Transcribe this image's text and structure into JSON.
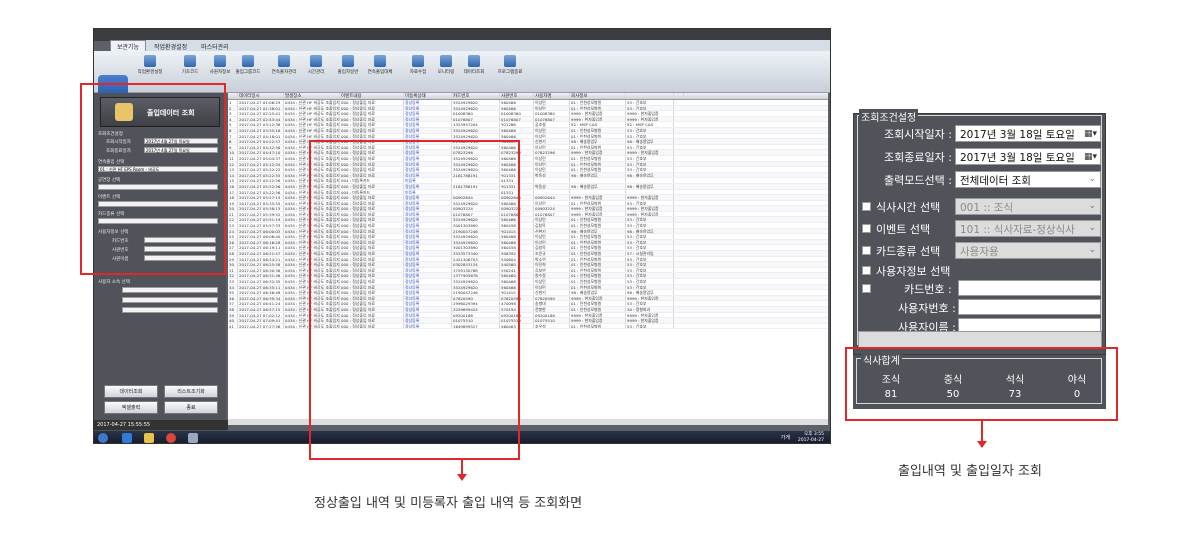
{
  "screenshot": {
    "menu": [
      "보관기능",
      "작업환경설정",
      "마스터관리"
    ],
    "ribbon": [
      "작업환경설정",
      "기초코드",
      "사원자정보",
      "출입그룹코드",
      "연속출자관리",
      "시간관리",
      "출입자일반",
      "연속출입대체",
      "자료수집",
      "모니터링",
      "데이터조회",
      "프로그램종료"
    ],
    "left_panel": {
      "title": "출입데이터 조회",
      "group": "조회조건설정",
      "rows": [
        {
          "label": "조회시작일자",
          "value": "2017년 4월 27일 목요일"
        },
        {
          "label": "조회종료일자",
          "value": "2017년 4월 27일 목요일"
        }
      ],
      "check1": "연속출입 선택",
      "check1_val": "01 : 신관 HF EPS Room - 비공도",
      "chk_lines": [
        "공연장 선택",
        "이벤트 선택",
        "카드종류 선택",
        "사용자정보 선택"
      ],
      "radio": [
        "카드번호",
        "사원번호",
        "사원이름"
      ],
      "chk2": "사용자 소속 선택",
      "buttons": [
        "데이터조회",
        "리스트조기화",
        "엑셀출력",
        "종료"
      ]
    },
    "grid_headers": [
      "",
      "데이터일시",
      "발생장소",
      "이벤트내용",
      "미등록상태",
      "카드번호",
      "사원번호",
      "사용자명",
      "회사정보",
      "",
      ""
    ],
    "grid_rows": [
      [
        "1",
        "2017-04-27 01:06:29",
        "0434 : 신관 HF 비공도 조출입자동문",
        "000 : 정상출입 자료",
        "정상등록",
        "3524929620",
        "560466",
        "이상민",
        "01 : 인천성모병원",
        "53 : 간호부"
      ],
      [
        "2",
        "2017-04-27 01:38:01",
        "0434 : 신관 HF 비공도 조출입자동문",
        "000 : 정상출입 자료",
        "정상등록",
        "3524929620",
        "560466",
        "이상민",
        "01 : 인천성모병원",
        "53 : 간호부"
      ],
      [
        "3",
        "2017-04-27 02:25:41",
        "0434 : 신관 HF 비공도 조출입자동문",
        "000 : 정상출입 자료",
        "정상등록",
        "01008380",
        "01008380",
        "01008380",
        "9999 : 한자출입증",
        "9999 : 한자출입증"
      ],
      [
        "4",
        "2017-04-27 02:43:44",
        "0434 : 신관 HF 비공도 조출입자동문",
        "000 : 정상출입 자료",
        "정상등록",
        "01076807",
        "01076807",
        "01076807",
        "9999 : 한자출입증",
        "9999 : 한자출입증"
      ],
      [
        "5",
        "2017-04-27 03:12:38",
        "0434 : 신관 HF 비공도 조출입자동문",
        "000 : 정상출입 자료",
        "정상등록",
        "1353957204",
        "Y01286",
        "공조설",
        "92 : MSP C&S",
        "92 : MSP C&S"
      ],
      [
        "6",
        "2017-04-27 03:35:16",
        "0434 : 신관 HF 비공도 조출입자동문",
        "000 : 정상출입 자료",
        "정상등록",
        "3524929620",
        "560466",
        "이상민",
        "01 : 인천성모병원",
        "53 : 간호부"
      ],
      [
        "7",
        "2017-04-27 04:18:01",
        "0434 : 신관 HF 비공도 조출입자동문",
        "000 : 정상출입 자료",
        "정상등록",
        "3524929620",
        "560466",
        "이상민",
        "01 : 인천성모병원",
        "53 : 간호부"
      ],
      [
        "8",
        "2017-04-27 04:22:57",
        "0434 : 신관 HF 비공도 조출입자동문",
        "000 : 정상출입 자료",
        "정상등록",
        "2190047246",
        "Y01415",
        "신현기",
        "98 : 배송용업무",
        "98 : 배송용업무"
      ],
      [
        "9",
        "2017-04-27 04:32:56",
        "0434 : 신관 HF 비공도 조출입자동문",
        "000 : 정상출입 자료",
        "정상등록",
        "3524929620",
        "560466",
        "이상민",
        "01 : 인천성모병원",
        "53 : 간호부"
      ],
      [
        "10",
        "2017-04-27 04:47:10",
        "0434 : 신관 HF 비공도 조출입자동문",
        "000 : 정상출입 자료",
        "정상등록",
        "07823296",
        "07823296",
        "07823296",
        "9999 : 한자출입증",
        "9999 : 한자출입증"
      ],
      [
        "11",
        "2017-04-27 05:04:37",
        "0434 : 신관 HF 비공도 조출입자동문",
        "000 : 정상출입 자료",
        "정상등록",
        "3524929620",
        "560466",
        "이상민",
        "01 : 인천성모병원",
        "53 : 간호부"
      ],
      [
        "12",
        "2017-04-27 05:12:55",
        "0434 : 신관 HF 비공도 조출입자동문",
        "000 : 정상출입 자료",
        "정상등록",
        "3524929620",
        "560466",
        "이상민",
        "01 : 인천성모병원",
        "53 : 간호부"
      ],
      [
        "13",
        "2017-04-27 05:22:22",
        "0434 : 신관 HF 비공도 조출입자동문",
        "000 : 정상출입 자료",
        "정상등록",
        "3524929620",
        "560466",
        "이상민",
        "01 : 인천성모병원",
        "53 : 간호부"
      ],
      [
        "14",
        "2017-04-27 05:22:55",
        "0434 : 신관 HF 비공도 조출입자동문",
        "000 : 정상출입 자료",
        "정상등록",
        "2161786191",
        "Y01331",
        "박동성",
        "98 : 배송용업무",
        "98 : 배송용업무"
      ],
      [
        "15",
        "2017-04-27 05:22:56",
        "0434 : 신관 HF 비공도 조출입자동문",
        "004 : 미등록카드",
        "미등록",
        "",
        "01331",
        "",
        "",
        ""
      ],
      [
        "16",
        "2017-04-27 05:22:56",
        "0434 : 신관 HF 비공도 조출입자동문",
        "000 : 정상출입 자료",
        "정상등록",
        "2161786191",
        "Y01331",
        "박동성",
        "98 : 배송용업무",
        "98 : 배송용업무"
      ],
      [
        "17",
        "2017-04-27 05:22:56",
        "0434 : 신관 HF 비공도 조출입자동문",
        "004 : 미등록카드",
        "미등록",
        "",
        "01331",
        "",
        "",
        ""
      ],
      [
        "18",
        "2017-04-27 05:27:13",
        "0434 : 신관 HF 비공도 조출입자동문",
        "000 : 정상출입 자료",
        "정상등록",
        "00902644",
        "00902644",
        "00902644",
        "9999 : 한자출입증",
        "9999 : 한자출입증"
      ],
      [
        "19",
        "2017-04-27 05:35:55",
        "0434 : 신관 HF 비공도 조출입자동문",
        "000 : 정상출입 자료",
        "정상등록",
        "3524929620",
        "560466",
        "이상민",
        "01 : 인천성모병원",
        "53 : 간호부"
      ],
      [
        "20",
        "2017-04-27 05:38:13",
        "0434 : 신관 HF 비공도 조출입자동문",
        "000 : 정상출입 자료",
        "정상등록",
        "00903224",
        "00903224",
        "00903224",
        "9999 : 한자출입증",
        "9999 : 한자출입증"
      ],
      [
        "21",
        "2017-04-27 05:39:52",
        "0434 : 신관 HF 비공도 조출입자동문",
        "000 : 정상출입 자료",
        "정상등록",
        "01076807",
        "01076807",
        "01076807",
        "9999 : 한자출입증",
        "9999 : 한자출입증"
      ],
      [
        "22",
        "2017-04-27 05:51:19",
        "0434 : 신관 HF 비공도 조출입자동문",
        "000 : 정상출입 자료",
        "정상등록",
        "3524929620",
        "560466",
        "이상민",
        "01 : 인천성모병원",
        "53 : 간호부"
      ],
      [
        "23",
        "2017-04-27 05:57:33",
        "0434 : 신관 HF 비공도 조출입자동문",
        "000 : 정상출입 자료",
        "정상등록",
        "3001303890",
        "560458",
        "김창옥",
        "01 : 인천성모병원",
        "53 : 간호부"
      ],
      [
        "24",
        "2017-04-27 06:00:03",
        "0434 : 신관 HF 비공도 조출입자동문",
        "000 : 정상출입 자료",
        "정상등록",
        "2190047246",
        "Y01415",
        "신현기",
        "98 : 배송용업무",
        "98 : 배송용업무"
      ],
      [
        "25",
        "2017-04-27 06:06:40",
        "0434 : 신관 HF 비공도 조출입자동문",
        "000 : 정상출입 자료",
        "정상등록",
        "3524929620",
        "560466",
        "이상민",
        "01 : 인천성모병원",
        "53 : 간호부"
      ],
      [
        "26",
        "2017-04-27 06:16:28",
        "0434 : 신관 HF 비공도 조출입자동문",
        "000 : 정상출입 자료",
        "정상등록",
        "3524929620",
        "560466",
        "이상민",
        "01 : 인천성모병원",
        "53 : 간호부"
      ],
      [
        "27",
        "2017-04-27 06:19:11",
        "0434 : 신관 HF 비공도 조출입자동문",
        "000 : 정상출입 자료",
        "정상등록",
        "3001303890",
        "560458",
        "김창옥",
        "01 : 인천성모병원",
        "53 : 간호부"
      ],
      [
        "28",
        "2017-04-27 06:21:57",
        "0434 : 신관 HF 비공도 조출입자동문",
        "000 : 정상출입 자료",
        "정상등록",
        "3553573340",
        "508392",
        "조윤규",
        "01 : 인천성모병원",
        "57 : 시설관리팀"
      ],
      [
        "29",
        "2017-04-27 06:24:21",
        "0434 : 신관 HF 비공도 조출입자동문",
        "000 : 정상출입 자료",
        "정상등록",
        "2421306703",
        "550604",
        "박소연",
        "01 : 인천성모병원",
        "53 : 간호부"
      ],
      [
        "30",
        "2017-04-27 06:25:58",
        "0434 : 신관 HF 비공도 조출입자동문",
        "000 : 정상출입 자료",
        "정상등록",
        "0302853134",
        "540580",
        "이진희",
        "01 : 인천성모병원",
        "53 : 간호부"
      ],
      [
        "31",
        "2017-04-27 06:30:36",
        "0434 : 신관 HF 비공도 조출입자동문",
        "000 : 정상출입 자료",
        "정상등록",
        "3759130768",
        "550241",
        "김보연",
        "01 : 인천성모병원",
        "53 : 간호부"
      ],
      [
        "32",
        "2017-04-27 06:31:46",
        "0434 : 신관 HF 비공도 조출입자동문",
        "000 : 정상출입 자료",
        "정상등록",
        "1377905678",
        "560460",
        "원수정",
        "01 : 인천성모병원",
        "53 : 간호부"
      ],
      [
        "33",
        "2017-04-27 06:32:35",
        "0434 : 신관 HF 비공도 조출입자동문",
        "000 : 정상출입 자료",
        "정상등록",
        "3524929620",
        "560466",
        "이상민",
        "01 : 인천성모병원",
        "53 : 간호부"
      ],
      [
        "34",
        "2017-04-27 06:35:11",
        "0434 : 신관 HF 비공도 조출입자동문",
        "000 : 정상출입 자료",
        "정상등록",
        "3524929620",
        "560466",
        "이상민",
        "01 : 인천성모병원",
        "53 : 간호부"
      ],
      [
        "35",
        "2017-04-27 06:36:48",
        "0434 : 신관 HF 비공도 조출입자동문",
        "000 : 정상출입 자료",
        "정상등록",
        "2190047246",
        "Y01415",
        "신현기",
        "98 : 배송용업무",
        "98 : 배송용업무"
      ],
      [
        "36",
        "2017-04-27 06:39:34",
        "0434 : 신관 HF 비공도 조출입자동문",
        "000 : 정상출입 자료",
        "정상등록",
        "07820590",
        "07820590",
        "07820590",
        "9999 : 한자출입증",
        "9999 : 한자출입증"
      ],
      [
        "37",
        "2017-04-27 06:41:24",
        "0434 : 신관 HF 비공도 조출입자동문",
        "000 : 정상출입 자료",
        "정상등록",
        "2996029394",
        "470098",
        "송병대",
        "01 : 인천성모병원",
        "53 : 간호부"
      ],
      [
        "38",
        "2017-04-27 06:57:15",
        "0434 : 신관 HF 비공도 조출입자동문",
        "000 : 정상출입 자료",
        "정상등록",
        "3259699424",
        "570194",
        "전봉한",
        "01 : 인천성모병원",
        "30 : 정형외과"
      ],
      [
        "39",
        "2017-04-27 07:02:12",
        "0434 : 신관 HF 비공도 조출입자동문",
        "000 : 정상출입 자료",
        "정상등록",
        "09200186",
        "09200186",
        "09200186",
        "9999 : 한자출입증",
        "9999 : 한자출입증"
      ],
      [
        "40",
        "2017-04-27 07:09:41",
        "0434 : 신관 HF 비공도 조출입자동문",
        "000 : 정상출입 자료",
        "정상등록",
        "01075510",
        "01075510",
        "01075510",
        "9999 : 한자출입증",
        "9999 : 한자출입증"
      ],
      [
        "41",
        "2017-04-27 07:27:56",
        "0434 : 신관 HF 비공도 조출입자동문",
        "000 : 정상출입 자료",
        "정상등록",
        "1649899527",
        "560463",
        "조우성",
        "01 : 인천성모병원",
        "53 : 간호부"
      ]
    ],
    "status_time": "2017-04-27 15:55:55",
    "tray": "가게",
    "clock": [
      "오후 3:55",
      "2017-04-27"
    ]
  },
  "callout_left": {
    "caption": "정상출입 내역 및 미등록자 출입 내역 등 조회화면"
  },
  "callout_right": {
    "caption": "출입내역 및 출입일자 조회"
  },
  "zoom_panel": {
    "group_title": "조회조건설정",
    "start_label": "조회시작일자 :",
    "start_value": "2017년   3월 18일 토요일",
    "end_label": "조회종료일자 :",
    "end_value": "2017년   3월 18일 토요일",
    "mode_label": "출력모드선택 :",
    "mode_value": "전체데이터 조회",
    "meal_time_label": "식사시간 선택",
    "meal_time_value": "001 :: 조식",
    "event_label": "이벤트 선택",
    "event_value": "101 :: 식사자료-정상식사",
    "card_type_label": "카드종류 선택",
    "card_type_value": "사용자용",
    "user_info_label": "사용자정보 선택",
    "card_no_label": "카드번호 :",
    "emp_no_label": "사용자번호 :",
    "emp_name_label": "사용자이름 :",
    "meal_title": "식사합계",
    "meal_heads": [
      "조식",
      "중식",
      "석식",
      "야식"
    ],
    "meal_values": [
      "81",
      "50",
      "73",
      "0"
    ]
  }
}
